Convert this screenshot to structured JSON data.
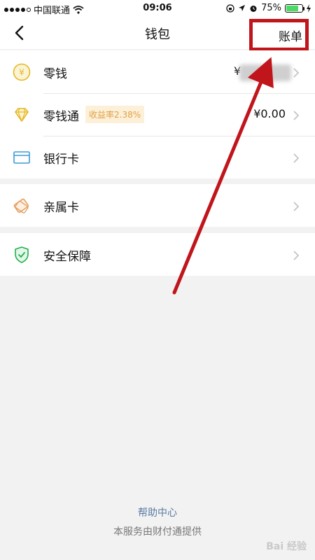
{
  "status_bar": {
    "carrier": "中国联通",
    "time": "09:06",
    "battery_percent": "75%",
    "battery_level": 0.75
  },
  "nav": {
    "title": "钱包",
    "bill_label": "账单"
  },
  "rows": [
    {
      "label": "零钱",
      "value_prefix": "¥",
      "icon": "yen-coin-icon"
    },
    {
      "label": "零钱通",
      "badge": "收益率2.38%",
      "value": "¥0.00",
      "icon": "diamond-icon"
    },
    {
      "label": "银行卡",
      "icon": "bank-card-icon"
    },
    {
      "label": "亲属卡",
      "icon": "family-card-icon"
    },
    {
      "label": "安全保障",
      "icon": "shield-check-icon"
    }
  ],
  "footer": {
    "help_center": "帮助中心",
    "service_note": "本服务由财付通提供"
  },
  "watermark": "Bai 经验",
  "colors": {
    "yellow_icon": "#e6b821",
    "blue_icon": "#3b9bd6",
    "orange_icon": "#e5a062",
    "green_icon": "#22b14c",
    "annotation_red": "#c0151b",
    "badge_bg": "#fdf0d9",
    "badge_text": "#e0a146"
  }
}
